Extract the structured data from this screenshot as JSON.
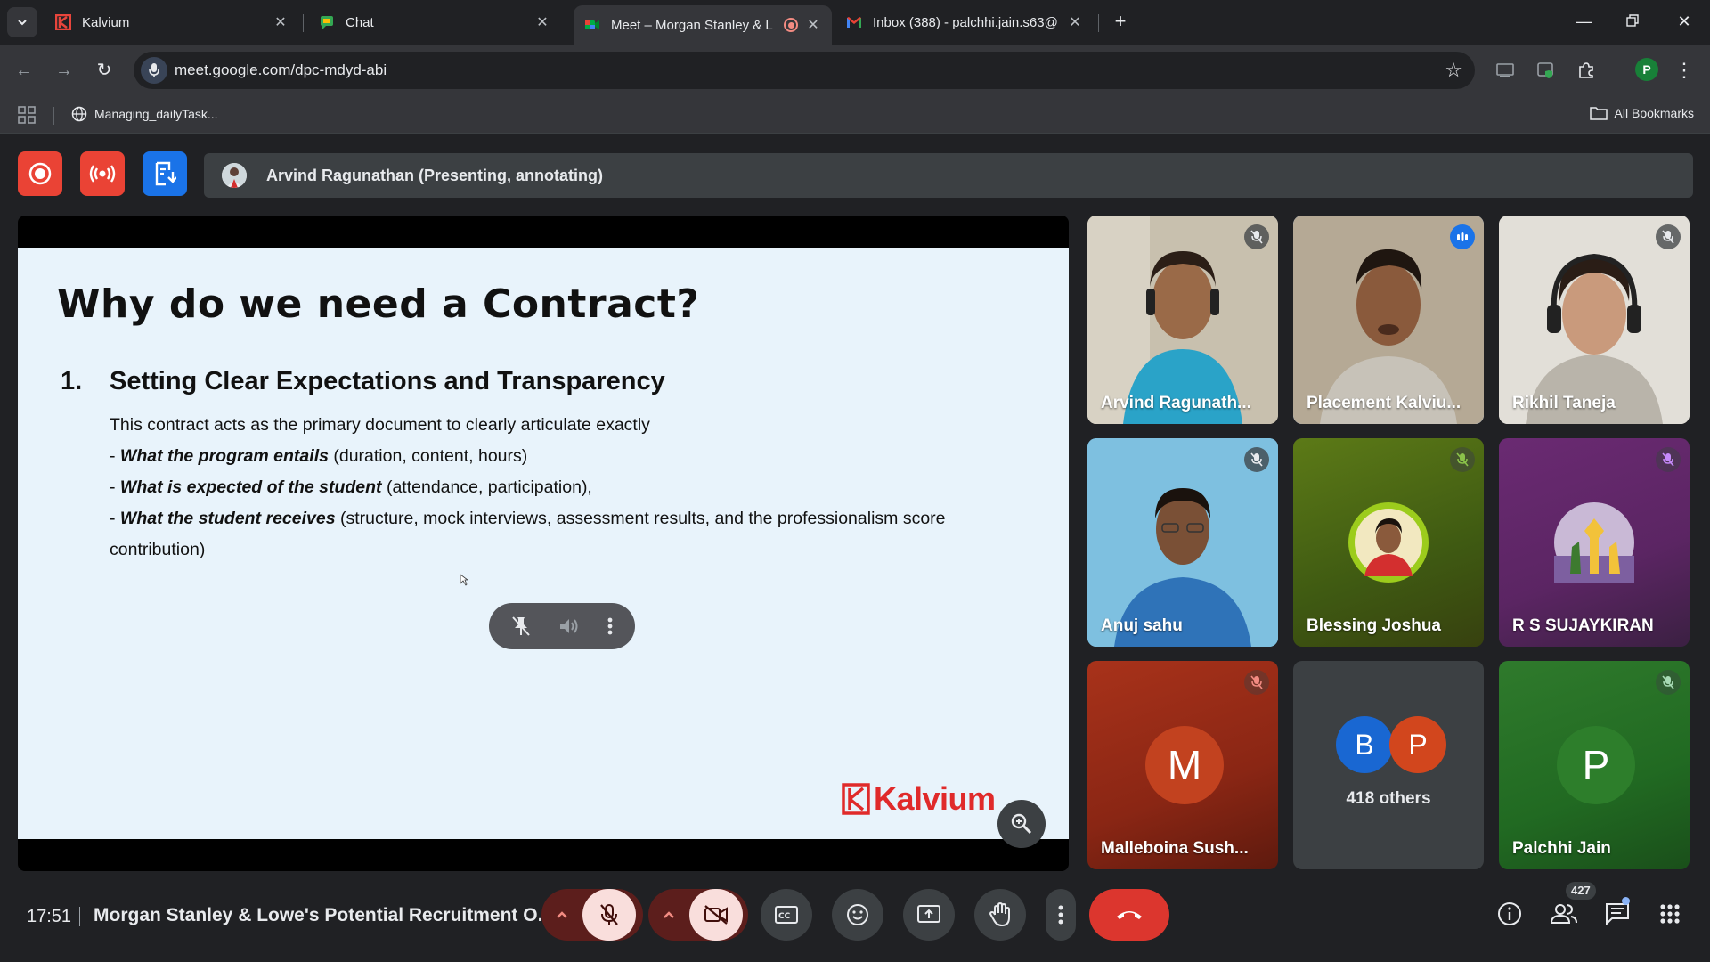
{
  "browser": {
    "tabs": [
      {
        "title": "Kalvium",
        "icon": "kalvium-icon"
      },
      {
        "title": "Chat",
        "icon": "google-chat-icon"
      },
      {
        "title": "Meet – Morgan Stanley & L",
        "icon": "google-meet-icon",
        "active": true
      },
      {
        "title": "Inbox (388) - palchhi.jain.s63@",
        "icon": "gmail-icon"
      }
    ],
    "url": "meet.google.com/dpc-mdyd-abi",
    "bookmarks": {
      "item": "Managing_dailyTask...",
      "all": "All Bookmarks"
    },
    "profile_initial": "P"
  },
  "meet": {
    "presenter_banner": "Arvind Ragunathan (Presenting, annotating)",
    "slide": {
      "title": "Why do we need a Contract?",
      "number": "1.",
      "heading": "Setting Clear Expectations and Transparency",
      "intro": "This contract acts as the primary document to clearly articulate exactly",
      "bullets": [
        {
          "prefix": "- ",
          "bold": "What the program entails",
          "rest": " (duration, content, hours)"
        },
        {
          "prefix": "- ",
          "bold": "What is expected of the student",
          "rest": " (attendance, participation),"
        },
        {
          "prefix": "- ",
          "bold": "What the student receives",
          "rest": " (structure, mock interviews, assessment results, and the professionalism score"
        }
      ],
      "bullet_cont": "contribution)",
      "logo_text": "Kalvium"
    },
    "participants": [
      {
        "name": "Arvind Ragunath...",
        "mic": "muted"
      },
      {
        "name": "Placement Kalviu...",
        "mic": "speaking"
      },
      {
        "name": "Rikhil Taneja",
        "mic": "muted"
      },
      {
        "name": "Anuj sahu",
        "mic": "muted"
      },
      {
        "name": "Blessing Joshua",
        "mic": "muted"
      },
      {
        "name": "R S SUJAYKIRAN",
        "mic": "muted"
      },
      {
        "name": "Malleboina Sush...",
        "mic": "muted",
        "initial": "M"
      },
      {
        "name": "418 others",
        "initials": [
          "B",
          "P"
        ]
      },
      {
        "name": "Palchhi Jain",
        "mic": "muted",
        "initial": "P"
      }
    ],
    "time": "17:51",
    "meeting_title": "Morgan Stanley & Lowe's Potential Recruitment O...",
    "people_count": "427"
  },
  "colors": {
    "accent_red": "#ea4335",
    "accent_blue": "#1a73e8",
    "end_call": "#dc362e",
    "bg": "#202124"
  }
}
